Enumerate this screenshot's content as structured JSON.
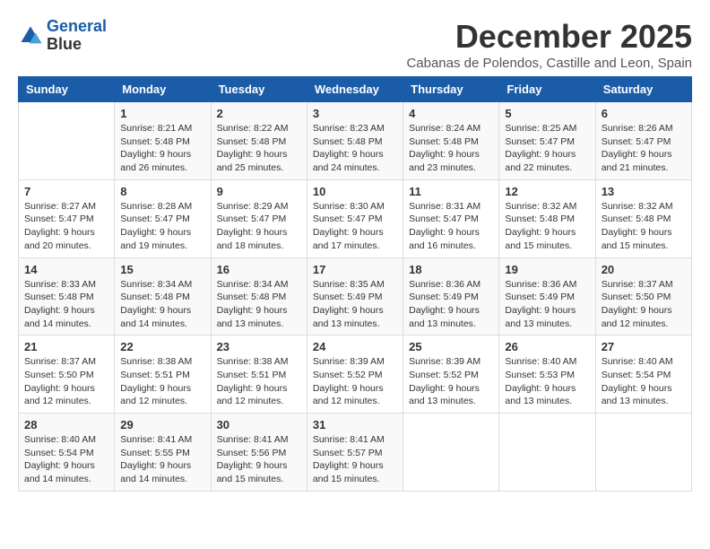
{
  "header": {
    "logo_line1": "General",
    "logo_line2": "Blue",
    "month_title": "December 2025",
    "location": "Cabanas de Polendos, Castille and Leon, Spain"
  },
  "days_of_week": [
    "Sunday",
    "Monday",
    "Tuesday",
    "Wednesday",
    "Thursday",
    "Friday",
    "Saturday"
  ],
  "weeks": [
    [
      {
        "day": "",
        "sunrise": "",
        "sunset": "",
        "daylight": ""
      },
      {
        "day": "1",
        "sunrise": "Sunrise: 8:21 AM",
        "sunset": "Sunset: 5:48 PM",
        "daylight": "Daylight: 9 hours and 26 minutes."
      },
      {
        "day": "2",
        "sunrise": "Sunrise: 8:22 AM",
        "sunset": "Sunset: 5:48 PM",
        "daylight": "Daylight: 9 hours and 25 minutes."
      },
      {
        "day": "3",
        "sunrise": "Sunrise: 8:23 AM",
        "sunset": "Sunset: 5:48 PM",
        "daylight": "Daylight: 9 hours and 24 minutes."
      },
      {
        "day": "4",
        "sunrise": "Sunrise: 8:24 AM",
        "sunset": "Sunset: 5:48 PM",
        "daylight": "Daylight: 9 hours and 23 minutes."
      },
      {
        "day": "5",
        "sunrise": "Sunrise: 8:25 AM",
        "sunset": "Sunset: 5:47 PM",
        "daylight": "Daylight: 9 hours and 22 minutes."
      },
      {
        "day": "6",
        "sunrise": "Sunrise: 8:26 AM",
        "sunset": "Sunset: 5:47 PM",
        "daylight": "Daylight: 9 hours and 21 minutes."
      }
    ],
    [
      {
        "day": "7",
        "sunrise": "Sunrise: 8:27 AM",
        "sunset": "Sunset: 5:47 PM",
        "daylight": "Daylight: 9 hours and 20 minutes."
      },
      {
        "day": "8",
        "sunrise": "Sunrise: 8:28 AM",
        "sunset": "Sunset: 5:47 PM",
        "daylight": "Daylight: 9 hours and 19 minutes."
      },
      {
        "day": "9",
        "sunrise": "Sunrise: 8:29 AM",
        "sunset": "Sunset: 5:47 PM",
        "daylight": "Daylight: 9 hours and 18 minutes."
      },
      {
        "day": "10",
        "sunrise": "Sunrise: 8:30 AM",
        "sunset": "Sunset: 5:47 PM",
        "daylight": "Daylight: 9 hours and 17 minutes."
      },
      {
        "day": "11",
        "sunrise": "Sunrise: 8:31 AM",
        "sunset": "Sunset: 5:47 PM",
        "daylight": "Daylight: 9 hours and 16 minutes."
      },
      {
        "day": "12",
        "sunrise": "Sunrise: 8:32 AM",
        "sunset": "Sunset: 5:48 PM",
        "daylight": "Daylight: 9 hours and 15 minutes."
      },
      {
        "day": "13",
        "sunrise": "Sunrise: 8:32 AM",
        "sunset": "Sunset: 5:48 PM",
        "daylight": "Daylight: 9 hours and 15 minutes."
      }
    ],
    [
      {
        "day": "14",
        "sunrise": "Sunrise: 8:33 AM",
        "sunset": "Sunset: 5:48 PM",
        "daylight": "Daylight: 9 hours and 14 minutes."
      },
      {
        "day": "15",
        "sunrise": "Sunrise: 8:34 AM",
        "sunset": "Sunset: 5:48 PM",
        "daylight": "Daylight: 9 hours and 14 minutes."
      },
      {
        "day": "16",
        "sunrise": "Sunrise: 8:34 AM",
        "sunset": "Sunset: 5:48 PM",
        "daylight": "Daylight: 9 hours and 13 minutes."
      },
      {
        "day": "17",
        "sunrise": "Sunrise: 8:35 AM",
        "sunset": "Sunset: 5:49 PM",
        "daylight": "Daylight: 9 hours and 13 minutes."
      },
      {
        "day": "18",
        "sunrise": "Sunrise: 8:36 AM",
        "sunset": "Sunset: 5:49 PM",
        "daylight": "Daylight: 9 hours and 13 minutes."
      },
      {
        "day": "19",
        "sunrise": "Sunrise: 8:36 AM",
        "sunset": "Sunset: 5:49 PM",
        "daylight": "Daylight: 9 hours and 13 minutes."
      },
      {
        "day": "20",
        "sunrise": "Sunrise: 8:37 AM",
        "sunset": "Sunset: 5:50 PM",
        "daylight": "Daylight: 9 hours and 12 minutes."
      }
    ],
    [
      {
        "day": "21",
        "sunrise": "Sunrise: 8:37 AM",
        "sunset": "Sunset: 5:50 PM",
        "daylight": "Daylight: 9 hours and 12 minutes."
      },
      {
        "day": "22",
        "sunrise": "Sunrise: 8:38 AM",
        "sunset": "Sunset: 5:51 PM",
        "daylight": "Daylight: 9 hours and 12 minutes."
      },
      {
        "day": "23",
        "sunrise": "Sunrise: 8:38 AM",
        "sunset": "Sunset: 5:51 PM",
        "daylight": "Daylight: 9 hours and 12 minutes."
      },
      {
        "day": "24",
        "sunrise": "Sunrise: 8:39 AM",
        "sunset": "Sunset: 5:52 PM",
        "daylight": "Daylight: 9 hours and 12 minutes."
      },
      {
        "day": "25",
        "sunrise": "Sunrise: 8:39 AM",
        "sunset": "Sunset: 5:52 PM",
        "daylight": "Daylight: 9 hours and 13 minutes."
      },
      {
        "day": "26",
        "sunrise": "Sunrise: 8:40 AM",
        "sunset": "Sunset: 5:53 PM",
        "daylight": "Daylight: 9 hours and 13 minutes."
      },
      {
        "day": "27",
        "sunrise": "Sunrise: 8:40 AM",
        "sunset": "Sunset: 5:54 PM",
        "daylight": "Daylight: 9 hours and 13 minutes."
      }
    ],
    [
      {
        "day": "28",
        "sunrise": "Sunrise: 8:40 AM",
        "sunset": "Sunset: 5:54 PM",
        "daylight": "Daylight: 9 hours and 14 minutes."
      },
      {
        "day": "29",
        "sunrise": "Sunrise: 8:41 AM",
        "sunset": "Sunset: 5:55 PM",
        "daylight": "Daylight: 9 hours and 14 minutes."
      },
      {
        "day": "30",
        "sunrise": "Sunrise: 8:41 AM",
        "sunset": "Sunset: 5:56 PM",
        "daylight": "Daylight: 9 hours and 15 minutes."
      },
      {
        "day": "31",
        "sunrise": "Sunrise: 8:41 AM",
        "sunset": "Sunset: 5:57 PM",
        "daylight": "Daylight: 9 hours and 15 minutes."
      },
      {
        "day": "",
        "sunrise": "",
        "sunset": "",
        "daylight": ""
      },
      {
        "day": "",
        "sunrise": "",
        "sunset": "",
        "daylight": ""
      },
      {
        "day": "",
        "sunrise": "",
        "sunset": "",
        "daylight": ""
      }
    ]
  ]
}
